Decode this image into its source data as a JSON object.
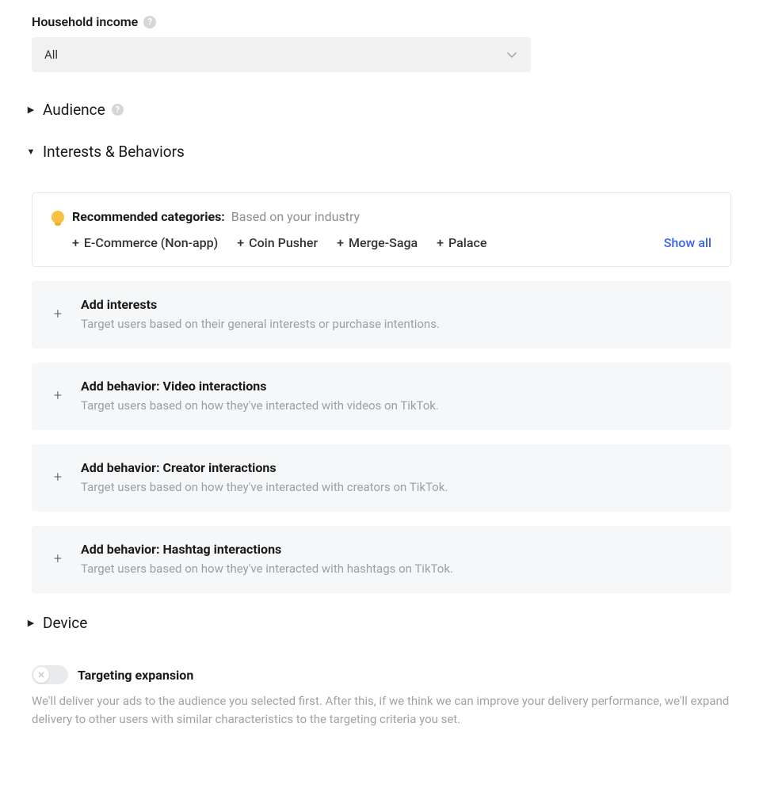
{
  "household": {
    "label": "Household income",
    "value": "All"
  },
  "accordions": {
    "audience": "Audience",
    "interests": "Interests & Behaviors",
    "device": "Device"
  },
  "recommended": {
    "title": "Recommended categories:",
    "subtitle": "Based on your industry",
    "show_all": "Show all",
    "chips": [
      "E-Commerce (Non-app)",
      "Coin Pusher",
      "Merge-Saga",
      "Palace"
    ]
  },
  "add_cards": [
    {
      "title": "Add interests",
      "desc": "Target users based on their general interests or purchase intentions."
    },
    {
      "title": "Add behavior: Video interactions",
      "desc": "Target users based on how they've interacted with videos on TikTok."
    },
    {
      "title": "Add behavior: Creator interactions",
      "desc": "Target users based on how they've interacted with creators on TikTok."
    },
    {
      "title": "Add behavior: Hashtag interactions",
      "desc": "Target users based on how they've interacted with hashtags on TikTok."
    }
  ],
  "expansion": {
    "title": "Targeting expansion",
    "desc": "We'll deliver your ads to the audience you selected first. After this, if we think we can improve your delivery performance, we'll expand delivery to other users with similar characteristics to the targeting criteria you set."
  }
}
